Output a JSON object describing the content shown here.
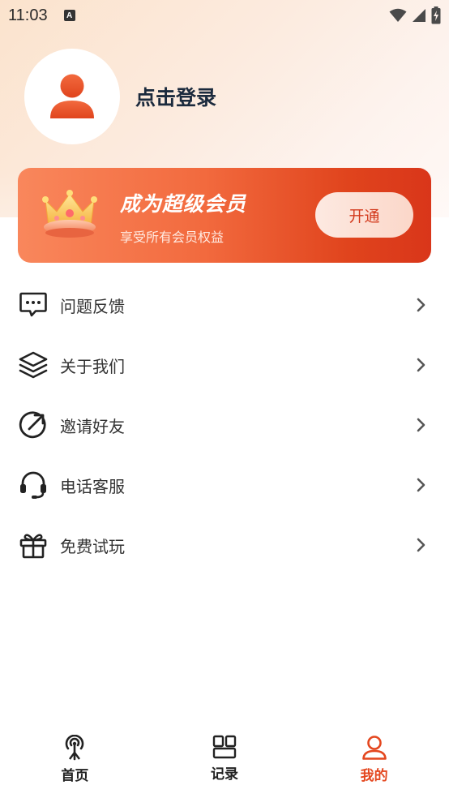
{
  "status_bar": {
    "time": "11:03",
    "notification_icon_letter": "A"
  },
  "profile": {
    "login_text": "点击登录"
  },
  "vip": {
    "title": "成为超级会员",
    "subtitle": "享受所有会员权益",
    "button_label": "开通"
  },
  "menu": {
    "items": [
      {
        "label": "问题反馈",
        "icon": "feedback-chat-icon"
      },
      {
        "label": "关于我们",
        "icon": "layers-icon"
      },
      {
        "label": "邀请好友",
        "icon": "share-arrow-icon"
      },
      {
        "label": "电话客服",
        "icon": "headset-icon"
      },
      {
        "label": "免费试玩",
        "icon": "gift-icon"
      }
    ]
  },
  "bottom_nav": {
    "items": [
      {
        "label": "首页",
        "icon": "antenna-icon",
        "active": false
      },
      {
        "label": "记录",
        "icon": "grid-icon",
        "active": false
      },
      {
        "label": "我的",
        "icon": "user-icon",
        "active": true
      }
    ]
  },
  "colors": {
    "accent": "#e4471f",
    "vip_gradient_start": "#f9875c",
    "vip_gradient_end": "#d9361a",
    "text_dark": "#1b2a3d"
  }
}
